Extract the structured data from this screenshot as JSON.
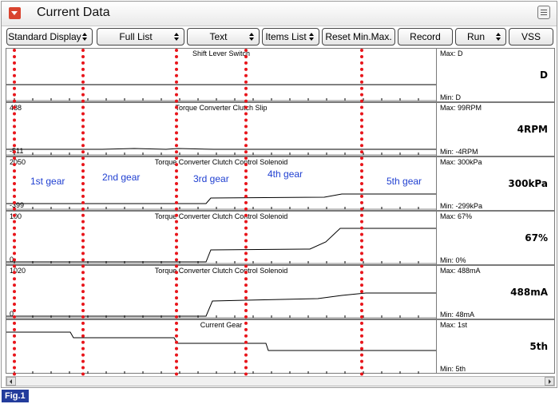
{
  "window": {
    "title": "Current Data"
  },
  "toolbar": {
    "standard_display": "Standard Display",
    "full_list": "Full List",
    "text": "Text",
    "items_list": "Items List",
    "reset": "Reset Min.Max.",
    "record": "Record",
    "run": "Run",
    "vss": "VSS"
  },
  "panels": [
    {
      "title": "Shift Lever Switch",
      "top_label": "",
      "bottom_label": "",
      "max": "Max: D",
      "min": "Min: D",
      "value": "D"
    },
    {
      "title": "Torque Converter Clutch Slip",
      "top_label": "488",
      "bottom_label": "-511",
      "max": "Max:   99RPM",
      "min": "Min:   -4RPM",
      "value": "4RPM"
    },
    {
      "title": "Torque Converter Clutch Control Solenoid",
      "top_label": "2050",
      "bottom_label": "-399",
      "max": "Max:  300kPa",
      "min": "Min:  -299kPa",
      "value": "300kPa"
    },
    {
      "title": "Torque Converter Clutch Control Solenoid",
      "top_label": "100",
      "bottom_label": "0",
      "max": "Max:   67%",
      "min": "Min:     0%",
      "value": "67%"
    },
    {
      "title": "Torque Converter Clutch Control Solenoid",
      "top_label": "1020",
      "bottom_label": "0",
      "max": "Max:  488mA",
      "min": "Min:    48mA",
      "value": "488mA"
    },
    {
      "title": "Current Gear",
      "top_label": "",
      "bottom_label": "",
      "max": "Max: 1st",
      "min": "Min: 5th",
      "value": "5th"
    }
  ],
  "gear_labels": [
    "1st gear",
    "2nd gear",
    "3rd gear",
    "4th gear",
    "5th gear"
  ],
  "figure_label": "Fig.1",
  "colors": {
    "marker": "#e8151b",
    "gear_text": "#1f3fd1",
    "fig_badge": "#233c9c",
    "collapse": "#d9442f"
  }
}
